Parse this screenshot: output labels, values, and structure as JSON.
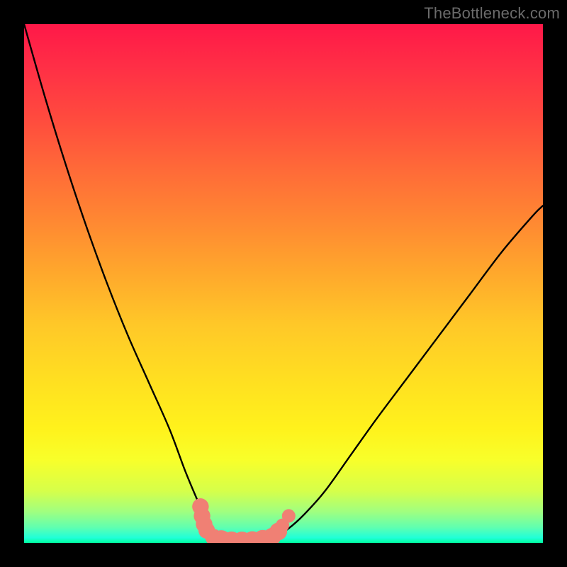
{
  "watermark": "TheBottleneck.com",
  "chart_data": {
    "type": "line",
    "title": "",
    "xlabel": "",
    "ylabel": "",
    "xlim": [
      0,
      100
    ],
    "ylim": [
      0,
      100
    ],
    "grid": false,
    "legend": false,
    "series": [
      {
        "name": "curve",
        "x": [
          0,
          4,
          8,
          12,
          16,
          20,
          24,
          28,
          31,
          33.5,
          35,
          36.5,
          38,
          40,
          42,
          44,
          46,
          48.5,
          51,
          54,
          58,
          63,
          68,
          74,
          80,
          86,
          92,
          98,
          100
        ],
        "y": [
          100,
          86,
          73,
          61,
          50,
          40,
          31,
          22,
          14,
          8,
          4.5,
          2.5,
          1.2,
          0.4,
          0.1,
          0.1,
          0.4,
          1.3,
          2.8,
          5.5,
          10,
          17,
          24,
          32,
          40,
          48,
          56,
          63,
          65
        ]
      },
      {
        "name": "markers",
        "points": [
          {
            "x": 34.0,
            "y": 7.0,
            "r": 1.6
          },
          {
            "x": 34.3,
            "y": 5.2,
            "r": 1.6
          },
          {
            "x": 34.7,
            "y": 3.6,
            "r": 1.6
          },
          {
            "x": 35.2,
            "y": 2.4,
            "r": 1.6
          },
          {
            "x": 36.5,
            "y": 1.1,
            "r": 1.6
          },
          {
            "x": 38.0,
            "y": 0.55,
            "r": 1.9
          },
          {
            "x": 40.0,
            "y": 0.3,
            "r": 1.9
          },
          {
            "x": 42.0,
            "y": 0.28,
            "r": 1.9
          },
          {
            "x": 44.0,
            "y": 0.35,
            "r": 1.9
          },
          {
            "x": 46.0,
            "y": 0.6,
            "r": 1.9
          },
          {
            "x": 47.8,
            "y": 1.2,
            "r": 1.7
          },
          {
            "x": 49.0,
            "y": 2.2,
            "r": 1.7
          },
          {
            "x": 49.8,
            "y": 3.4,
            "r": 1.3
          },
          {
            "x": 51.0,
            "y": 5.2,
            "r": 1.3
          }
        ]
      }
    ],
    "colors": {
      "curve": "#000000",
      "markers": "#f08074"
    }
  }
}
